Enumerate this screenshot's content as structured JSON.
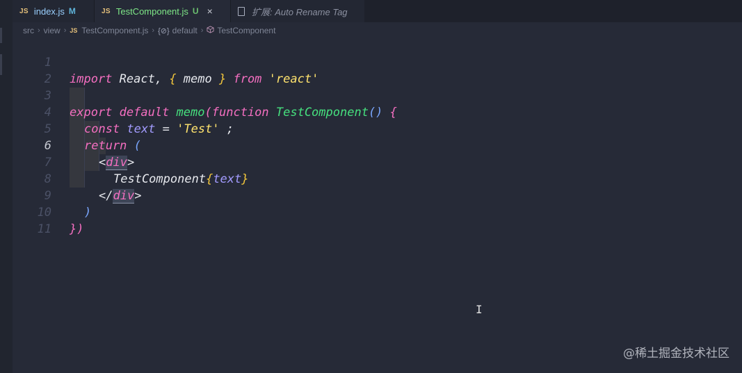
{
  "tabs": [
    {
      "icon": "JS",
      "name": "index.js",
      "status": "M"
    },
    {
      "icon": "JS",
      "name": "TestComponent.js",
      "status": "U",
      "close": "×"
    },
    {
      "name": "扩展: Auto Rename Tag"
    }
  ],
  "breadcrumb": {
    "items": [
      "src",
      "view",
      "TestComponent.js",
      "default",
      "TestComponent"
    ],
    "js_icon": "JS",
    "symbol_icon": "{⊘}",
    "separator": "›"
  },
  "editor": {
    "line_numbers": [
      "1",
      "2",
      "3",
      "4",
      "5",
      "6",
      "7",
      "8",
      "9",
      "10",
      "11"
    ],
    "current_line": "6",
    "lines": {
      "l1": {
        "kw1": "import",
        "id1": " React, ",
        "b1": "{",
        "id2": " memo ",
        "b2": "}",
        "kw2": " from ",
        "str1": "'react'"
      },
      "l3": {
        "kw1": "export",
        "kw2": " default ",
        "fn1": "memo",
        "p1": "(",
        "kw3": "function",
        "fn2": " TestComponent",
        "p2": "()",
        "b1": " {"
      },
      "l4": {
        "kw1": "const",
        "var1": " text",
        "id1": " = ",
        "str1": "'Test'",
        "id2": " ;"
      },
      "l5": {
        "kw1": "return",
        "p1": " ("
      },
      "l6": {
        "lt": "<",
        "tag": "div",
        "gt": ">"
      },
      "l7": {
        "text": "TestComponent",
        "b1": "{",
        "var1": "text",
        "b2": "}"
      },
      "l8": {
        "lt": "</",
        "tag": "div",
        "gt": ">"
      },
      "l9": {
        "p1": ")"
      },
      "l10": {
        "b1": "}",
        "p1": ")"
      }
    }
  },
  "cursor_glyph": "I",
  "watermark": "@稀土掘金技术社区",
  "colors": {
    "background": "#262a37",
    "keyword": "#f56fc1",
    "function": "#46e07e",
    "string": "#ffe36e",
    "variable": "#a29bfe",
    "brace": "#f3c73c"
  }
}
